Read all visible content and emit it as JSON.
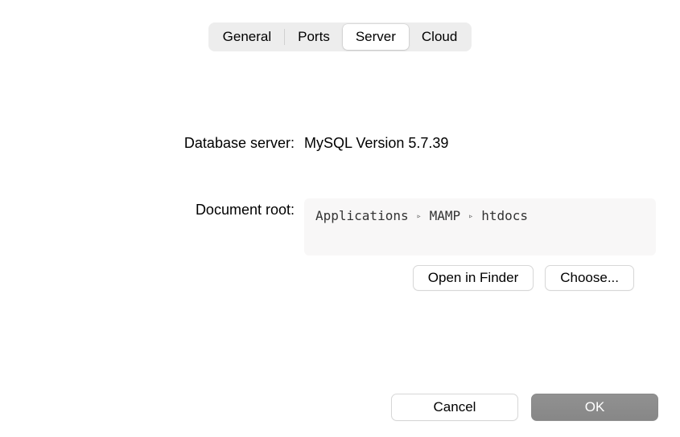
{
  "tabs": {
    "general": "General",
    "ports": "Ports",
    "server": "Server",
    "cloud": "Cloud",
    "active": "server"
  },
  "server": {
    "db_label": "Database server:",
    "db_value": "MySQL Version 5.7.39",
    "docroot_label": "Document root:",
    "docroot_path": [
      "Applications",
      "MAMP",
      "htdocs"
    ],
    "open_in_finder": "Open in Finder",
    "choose": "Choose..."
  },
  "footer": {
    "cancel": "Cancel",
    "ok": "OK"
  }
}
